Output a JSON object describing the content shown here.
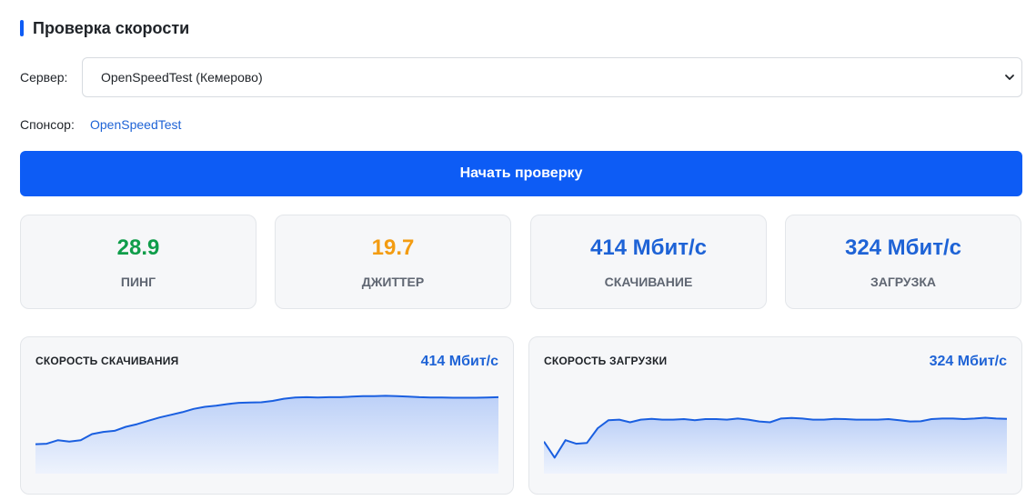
{
  "header": {
    "title": "Проверка скорости"
  },
  "server": {
    "label": "Сервер:",
    "selected": "OpenSpeedTest (Кемерово)"
  },
  "sponsor": {
    "label": "Спонсор:",
    "link_text": "OpenSpeedTest"
  },
  "start_button": {
    "label": "Начать проверку"
  },
  "stats": {
    "ping": {
      "value": "28.9",
      "label": "ПИНГ",
      "color": "#0f9d4a"
    },
    "jitter": {
      "value": "19.7",
      "label": "ДЖИТТЕР",
      "color": "#f39c12"
    },
    "download": {
      "value": "414 Мбит/с",
      "label": "СКАЧИВАНИЕ",
      "color": "#1e63d6"
    },
    "upload": {
      "value": "324 Мбит/с",
      "label": "ЗАГРУЗКА",
      "color": "#1e63d6"
    }
  },
  "colors": {
    "accent": "#0d5cf5",
    "line": "#1a5fe0",
    "fill": "#dbe6fb"
  },
  "charts": {
    "download": {
      "title": "СКОРОСТЬ СКАЧИВАНИЯ",
      "value": "414 Мбит/с"
    },
    "upload": {
      "title": "СКОРОСТЬ ЗАГРУЗКИ",
      "value": "324 Мбит/с"
    }
  },
  "chart_data": [
    {
      "type": "area",
      "title": "СКОРОСТЬ СКАЧИВАНИЯ",
      "series": [
        {
          "values": [
            230,
            232,
            245,
            240,
            245,
            268,
            276,
            280,
            295,
            305,
            318,
            330,
            340,
            350,
            362,
            370,
            374,
            380,
            385,
            386,
            387,
            392,
            400,
            405,
            406,
            405,
            406,
            406,
            408,
            410,
            410,
            411,
            410,
            408,
            406,
            405,
            405,
            404,
            404,
            404,
            405,
            406
          ]
        }
      ]
    },
    {
      "type": "area",
      "title": "СКОРОСТЬ ЗАГРУЗКИ",
      "series": [
        {
          "values": [
            240,
            180,
            245,
            232,
            235,
            290,
            320,
            322,
            312,
            322,
            325,
            322,
            322,
            324,
            320,
            324,
            324,
            322,
            326,
            322,
            315,
            312,
            326,
            328,
            326,
            322,
            322,
            325,
            324,
            322,
            322,
            322,
            324,
            320,
            315,
            316,
            324,
            326,
            326,
            324,
            326,
            329,
            326,
            325
          ]
        }
      ]
    }
  ]
}
